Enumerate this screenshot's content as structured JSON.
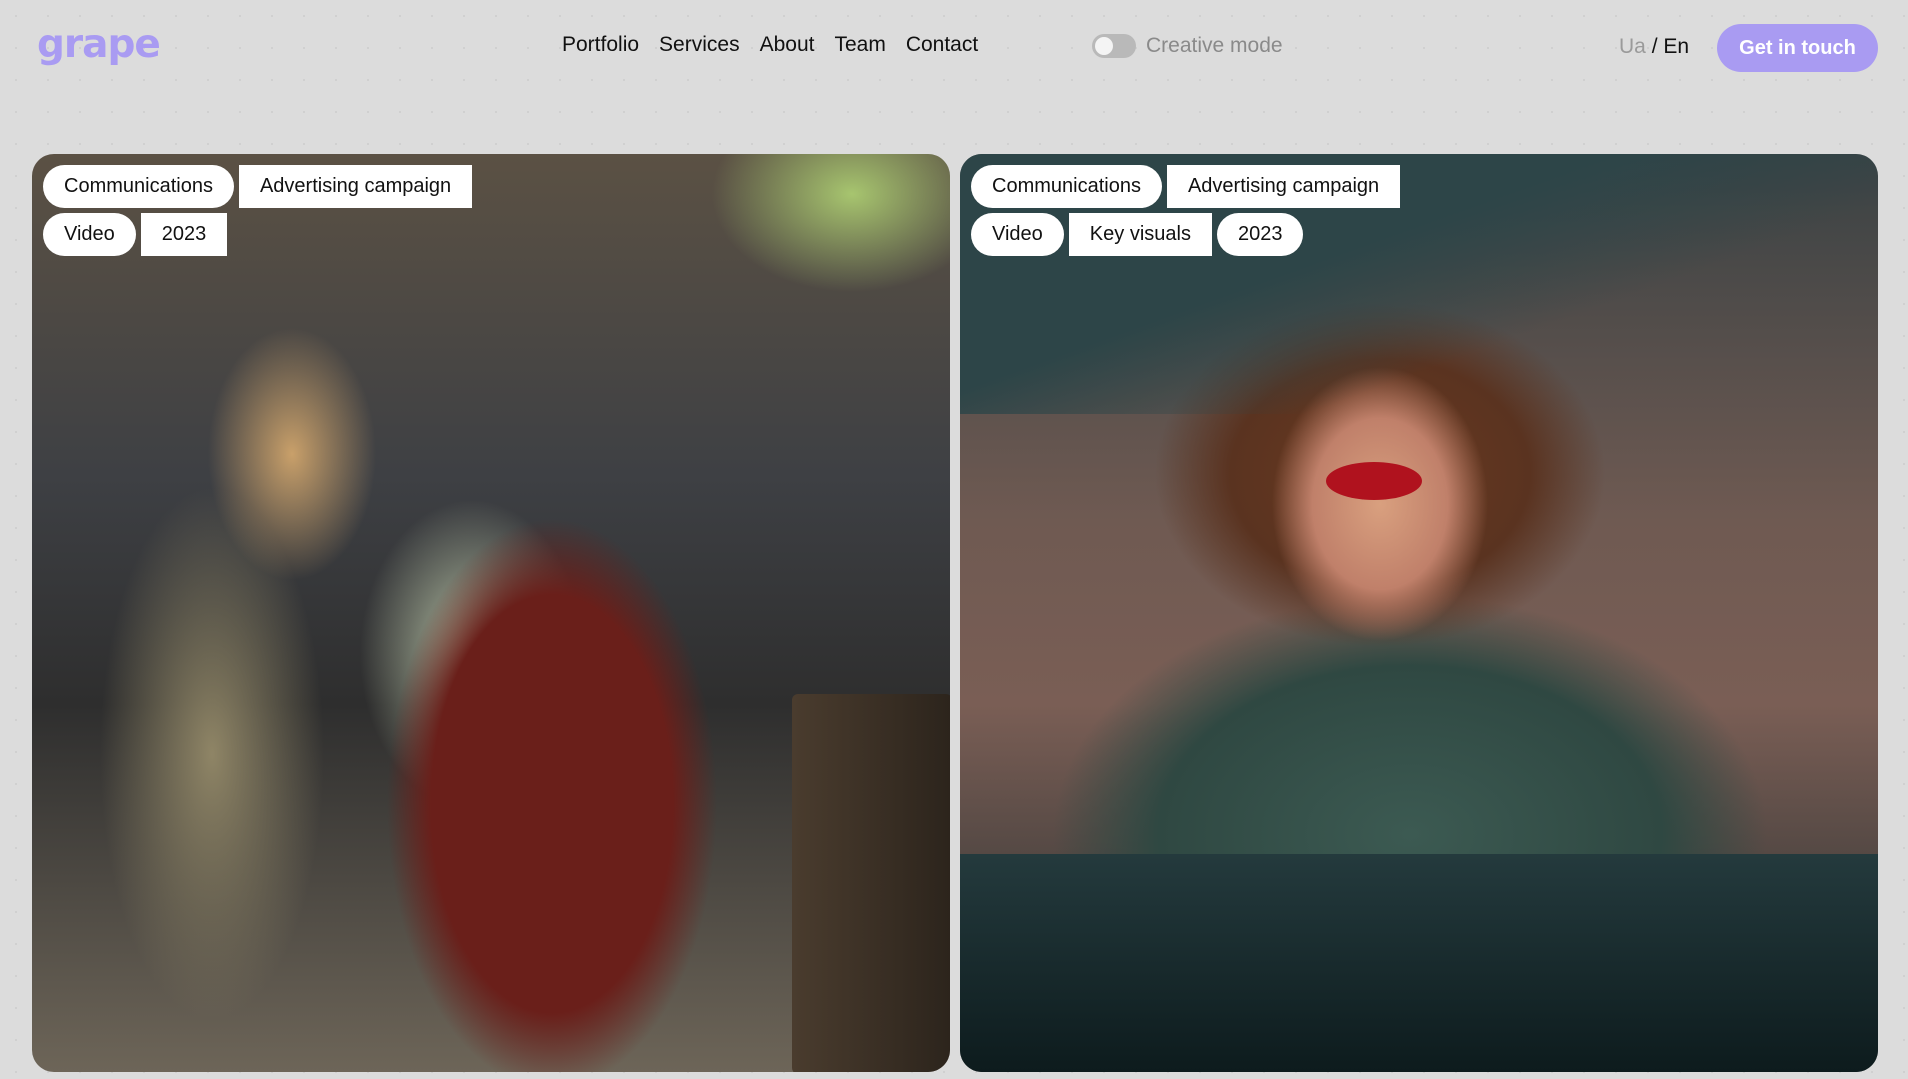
{
  "header": {
    "logo": "grape",
    "nav": [
      "Portfolio",
      "Services",
      "About",
      "Team",
      "Contact"
    ],
    "creative_mode_label": "Creative mode",
    "creative_mode_on": false,
    "lang_ua": "Ua",
    "lang_separator": "/",
    "lang_en": "En",
    "cta_label": "Get in touch"
  },
  "projects": [
    {
      "tags_row1": [
        "Communications",
        "Advertising campaign"
      ],
      "tags_row2": [
        "Video",
        "2023"
      ]
    },
    {
      "tags_row1": [
        "Communications",
        "Advertising campaign"
      ],
      "tags_row2": [
        "Video",
        "Key visuals",
        "2023"
      ]
    }
  ],
  "colors": {
    "accent": "#a99bf2",
    "background": "#dcdcdc"
  }
}
